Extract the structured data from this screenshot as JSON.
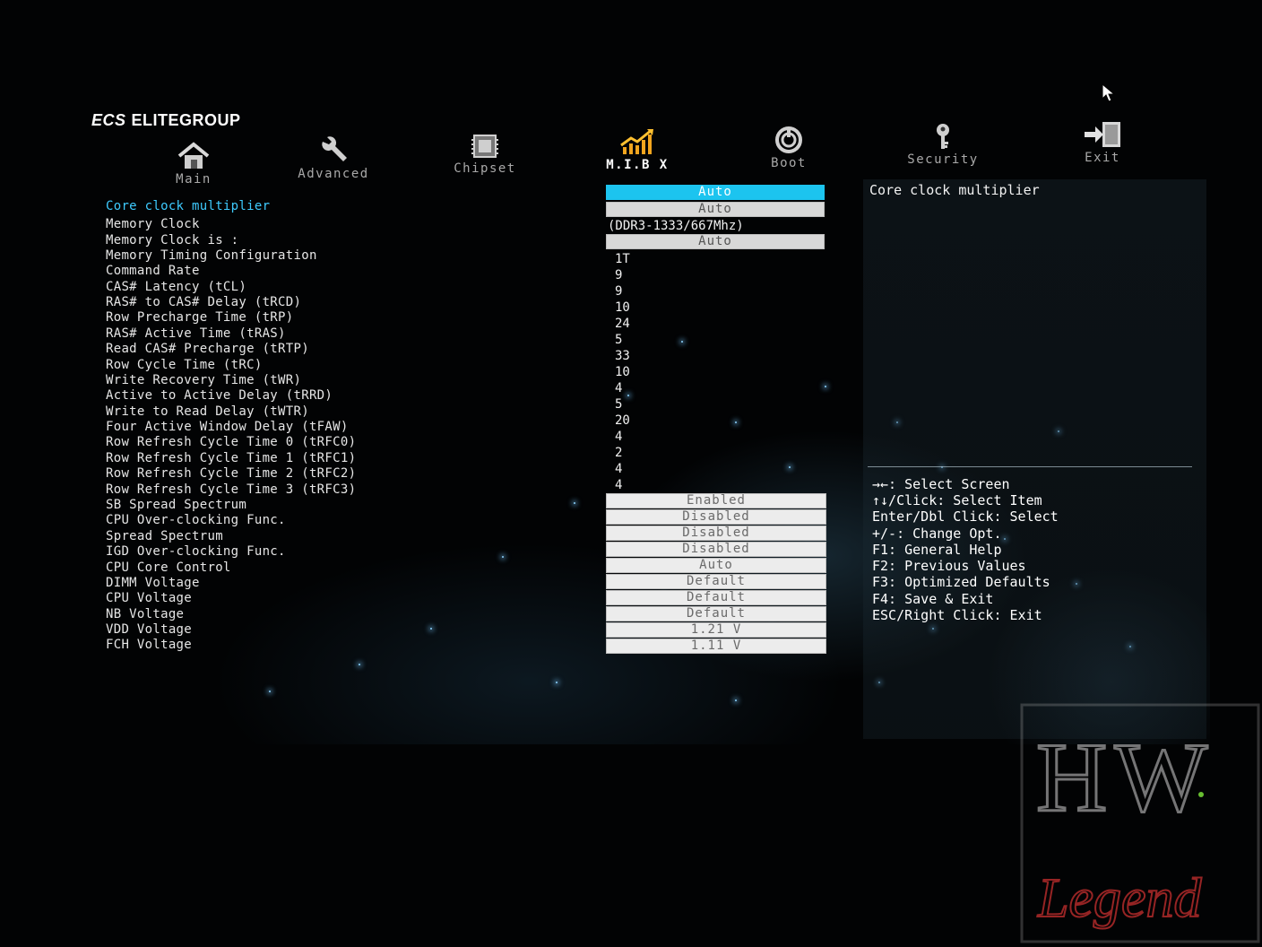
{
  "brand": {
    "name": "ELITEGROUP",
    "mark": "ECS"
  },
  "tabs": [
    {
      "label": "Main",
      "icon": "house-icon"
    },
    {
      "label": "Advanced",
      "icon": "wrench-icon"
    },
    {
      "label": "Chipset",
      "icon": "chip-icon"
    },
    {
      "label": "M.I.B X",
      "icon": "chart-arrow-icon",
      "active": true
    },
    {
      "label": "Boot",
      "icon": "power-icon"
    },
    {
      "label": "Security",
      "icon": "key-icon"
    },
    {
      "label": "Exit",
      "icon": "exit-door-icon"
    }
  ],
  "settings": [
    {
      "label": "Core clock multiplier",
      "value": "Auto",
      "kind": "box-selected"
    },
    {
      "label": "Memory Clock",
      "value": "Auto",
      "kind": "box-grey"
    },
    {
      "label": "Memory Clock is :",
      "value": "(DDR3-1333/667Mhz)",
      "kind": "text"
    },
    {
      "label": "Memory Timing Configuration",
      "value": "Auto",
      "kind": "box-grey"
    },
    {
      "label": "Command Rate",
      "value": "1T",
      "kind": "text"
    },
    {
      "label": "CAS# Latency (tCL)",
      "value": "9",
      "kind": "text"
    },
    {
      "label": "RAS# to CAS# Delay (tRCD)",
      "value": "9",
      "kind": "text"
    },
    {
      "label": "Row Precharge Time (tRP)",
      "value": "10",
      "kind": "text"
    },
    {
      "label": "RAS# Active Time (tRAS)",
      "value": "24",
      "kind": "text"
    },
    {
      "label": "Read CAS# Precharge (tRTP)",
      "value": "5",
      "kind": "text"
    },
    {
      "label": "Row Cycle Time (tRC)",
      "value": "33",
      "kind": "text"
    },
    {
      "label": "Write Recovery Time (tWR)",
      "value": "10",
      "kind": "text"
    },
    {
      "label": "Active to Active Delay (tRRD)",
      "value": "4",
      "kind": "text"
    },
    {
      "label": "Write to Read Delay (tWTR)",
      "value": "5",
      "kind": "text"
    },
    {
      "label": "Four Active Window Delay (tFAW)",
      "value": "20",
      "kind": "text"
    },
    {
      "label": "Row Refresh Cycle Time 0 (tRFC0)",
      "value": "4",
      "kind": "text"
    },
    {
      "label": "Row Refresh Cycle Time 1 (tRFC1)",
      "value": "2",
      "kind": "text"
    },
    {
      "label": "Row Refresh Cycle Time 2 (tRFC2)",
      "value": "4",
      "kind": "text"
    },
    {
      "label": "Row Refresh Cycle Time 3 (tRFC3)",
      "value": "4",
      "kind": "text"
    },
    {
      "label": "SB Spread Spectrum",
      "value": "Enabled",
      "kind": "box"
    },
    {
      "label": "CPU Over-clocking Func.",
      "value": "Disabled",
      "kind": "box"
    },
    {
      "label": "Spread Spectrum",
      "value": "Disabled",
      "kind": "box"
    },
    {
      "label": "IGD Over-clocking Func.",
      "value": "Disabled",
      "kind": "box"
    },
    {
      "label": "CPU Core Control",
      "value": "Auto",
      "kind": "box"
    },
    {
      "label": "DIMM Voltage",
      "value": "Default",
      "kind": "box"
    },
    {
      "label": "CPU Voltage",
      "value": "Default",
      "kind": "box"
    },
    {
      "label": "NB Voltage",
      "value": "Default",
      "kind": "box"
    },
    {
      "label": "VDD Voltage",
      "value": "1.21 V",
      "kind": "box"
    },
    {
      "label": "FCH Voltage",
      "value": "1.11 V",
      "kind": "box"
    }
  ],
  "help": {
    "title": "Core clock multiplier",
    "keys": [
      "→←: Select Screen",
      "↑↓/Click: Select Item",
      "Enter/Dbl Click: Select",
      "+/-: Change Opt.",
      "F1: General Help",
      "F2: Previous Values",
      "F3: Optimized Defaults",
      "F4: Save & Exit",
      "ESC/Right Click: Exit"
    ]
  },
  "watermark": {
    "top": "HW",
    "bottom": "Legend"
  },
  "colors": {
    "accent": "#1cc4ef",
    "selected_label": "#3ecbff",
    "box_bg": "#ececec"
  }
}
